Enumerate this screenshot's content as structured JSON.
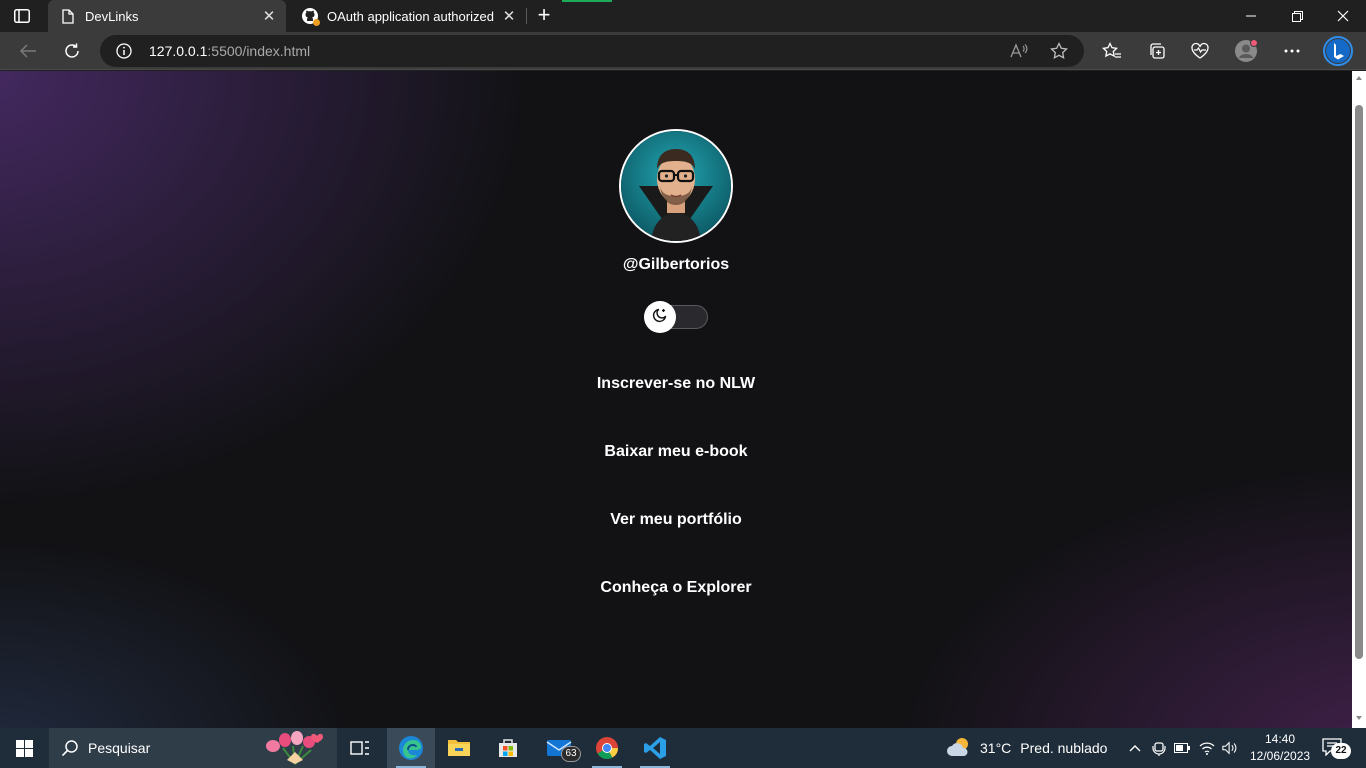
{
  "browser": {
    "tabs": [
      {
        "title": "DevLinks",
        "icon": "page-icon",
        "active": true
      },
      {
        "title": "OAuth application authorized",
        "icon": "github-icon",
        "active": false
      }
    ],
    "url_host": "127.0.0.1",
    "url_rest": ":5500/index.html"
  },
  "page": {
    "username": "@Gilbertorios",
    "theme_toggle": "dark-mode-moon-icon",
    "links": [
      "Inscrever-se no NLW",
      "Baixar meu e-book",
      "Ver meu portfólio",
      "Conheça o Explorer"
    ]
  },
  "taskbar": {
    "search_placeholder": "Pesquisar",
    "mail_badge": "63",
    "weather_temp": "31°C",
    "weather_desc": "Pred. nublado",
    "time": "14:40",
    "date": "12/06/2023",
    "notification_count": "22"
  },
  "colors": {
    "page_bg": "#121215",
    "accent_purple": "#6e3ca0",
    "avatar_teal": "#1a8a96"
  }
}
